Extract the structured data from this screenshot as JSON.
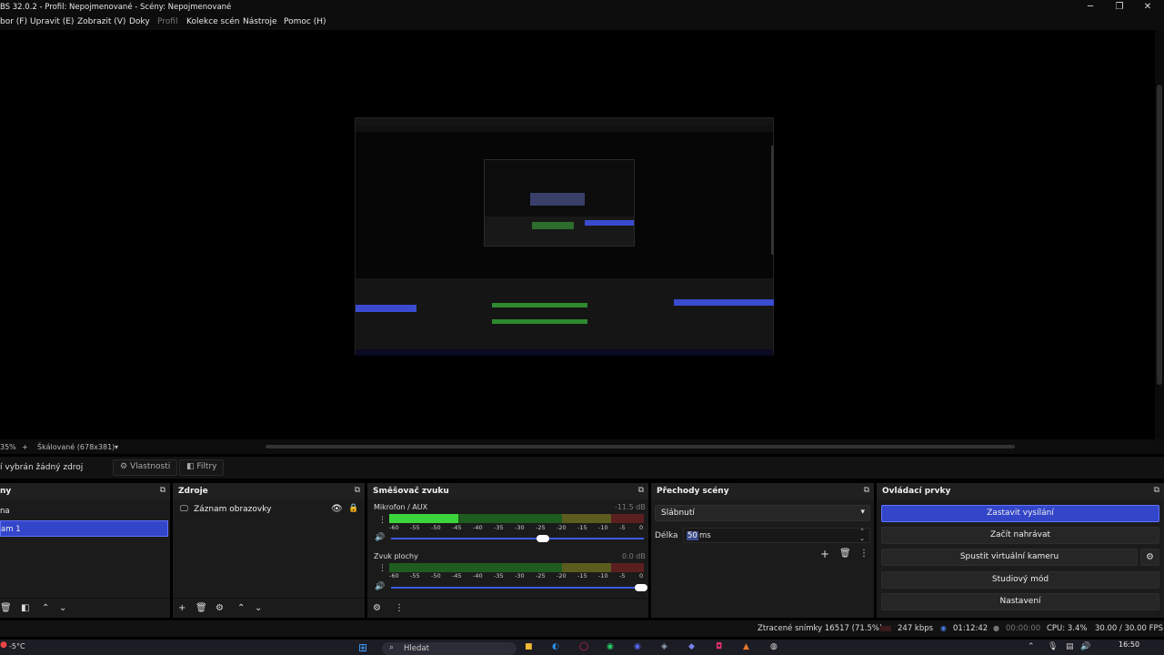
{
  "window": {
    "title": "BS 32.0.2 - Profil: Nepojmenované - Scény: Nepojmenované",
    "minimize": "─",
    "maximize": "❐",
    "close": "✕"
  },
  "menu": [
    "bor (F)",
    "Upravit (E)",
    "Zobrazit (V)",
    "Doky",
    "Profil",
    "Kolekce scén",
    "Nástroje",
    "Pomoc (H)"
  ],
  "preview_bar": {
    "zoom": "35%",
    "plus": "+",
    "scale_label": "Škálované (678x381)",
    "dropdown": "▾"
  },
  "source_bar": {
    "no_source": "í vybrán žádný zdroj",
    "properties": "Vlastnosti",
    "filters": "Filtry"
  },
  "scenes": {
    "title": "ny",
    "items": [
      "na",
      "am 1"
    ]
  },
  "sources": {
    "title": "Zdroje",
    "items": [
      "Záznam obrazovky"
    ]
  },
  "mixer": {
    "title": "Směšovač zvuku",
    "channels": [
      {
        "name": "Mikrofon / AUX",
        "db": "-11.5 dB",
        "level": 0.27,
        "volume": 0.61
      },
      {
        "name": "Zvuk plochy",
        "db": "0.0 dB",
        "level": 0.0,
        "volume": 1.0
      }
    ],
    "ticks": [
      "-60",
      "-55",
      "-50",
      "-45",
      "-40",
      "-35",
      "-30",
      "-25",
      "-20",
      "-15",
      "-10",
      "-5",
      "0"
    ]
  },
  "transitions": {
    "title": "Přechody scény",
    "selected": "Slábnutí",
    "duration_label": "Délka",
    "duration_value": "50",
    "duration_unit": "ms"
  },
  "controls": {
    "title": "Ovládací prvky",
    "buttons": [
      "Zastavit vysílání",
      "Začít nahrávat",
      "Spustit virtuální kameru",
      "Studiový mód",
      "Nastavení"
    ]
  },
  "status": {
    "dropped": "Ztracené snímky 16517 (71.5%)",
    "bitrate": "247 kbps",
    "stream_time": "01:12:42",
    "rec_time": "00:00:00",
    "cpu": "CPU: 3.4%",
    "fps": "30.00 / 30.00 FPS"
  },
  "taskbar": {
    "weather": "-5°C",
    "search": "Hledat",
    "time": "16:50"
  },
  "colors": {
    "accent": "#3346c9",
    "meter_green": "#2e8a2e",
    "meter_yellow": "#8a8a2e",
    "meter_red": "#8a2e2e"
  }
}
